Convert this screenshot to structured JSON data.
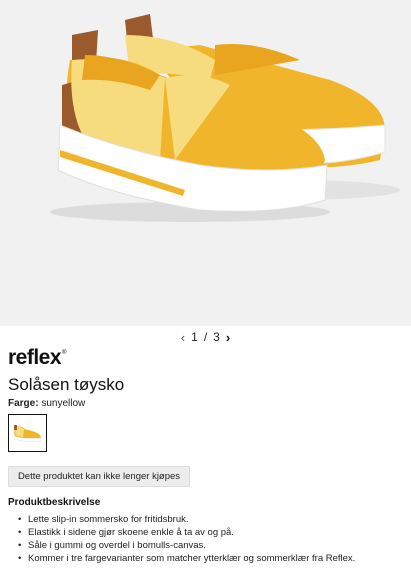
{
  "gallery": {
    "current": "1",
    "separator": "/",
    "total": "3",
    "prev_icon": "chevron-left-icon",
    "next_icon": "chevron-right-icon"
  },
  "product": {
    "brand": "reflex",
    "brand_mark": "®",
    "title": "Solåsen tøysko",
    "color_label": "Farge:",
    "color_value": "sunyellow",
    "status_button": "Dette produktet kan ikke lenger kjøpes"
  },
  "description": {
    "heading": "Produktbeskrivelse",
    "items": [
      "Lette slip-in sommersko for fritidsbruk.",
      "Elastikk i sidene gjør skoene enkle å ta av og på.",
      "Såle i gummi og overdel i bomulls-canvas.",
      "Kommer i tre fargevarianter som matcher ytterklær og sommerklær fra Reflex."
    ]
  },
  "colors": {
    "shoe_yellow": "#f0b52a",
    "shoe_pale": "#f6dc7e",
    "heel_brown": "#9a5a2c",
    "sole_white": "#ffffff",
    "background": "#f1f1f1"
  }
}
